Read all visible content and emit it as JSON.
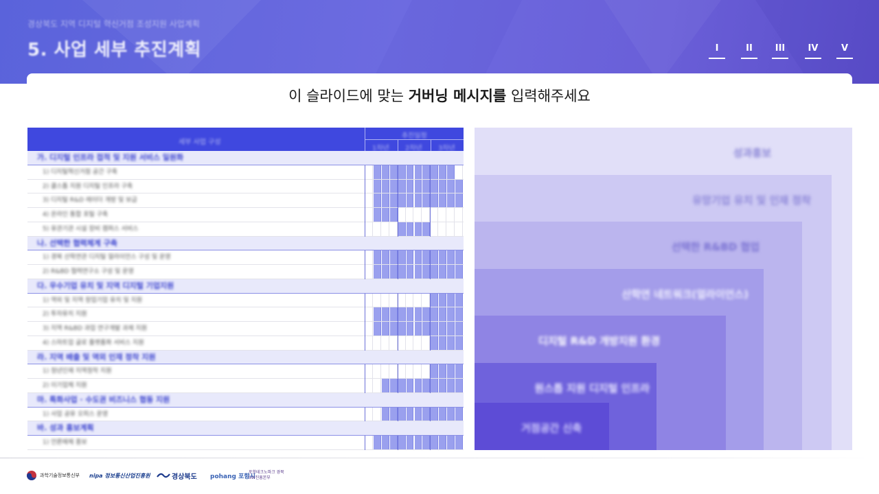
{
  "header": {
    "breadcrumb": "경상북도 지역 디지털 혁신거점 조성지원 사업계획",
    "title": "5. 사업 세부 추진계획",
    "nav": [
      "I",
      "II",
      "III",
      "IV",
      "V"
    ]
  },
  "governing_message": {
    "prefix": "이 슬라이드에 맞는 ",
    "bold": "거버닝 메시지를",
    "suffix": " 입력해주세요"
  },
  "table": {
    "header_left": "세부 사업 구성",
    "header_group": "추진일정",
    "header_years": [
      "1차년",
      "2차년",
      "3차년"
    ],
    "rows": [
      {
        "type": "cat",
        "label": "가. 디지털 인프라 접적 및 지원 서비스 일원화"
      },
      {
        "type": "sub",
        "label": "1) 디지털혁신거점 공간 구축",
        "fill": [
          0,
          1,
          1,
          1,
          1,
          1,
          1,
          1,
          1,
          1,
          1,
          0
        ]
      },
      {
        "type": "sub",
        "label": "2) 클스톱 지원 디지털 인프라 구축",
        "fill": [
          0,
          1,
          1,
          1,
          1,
          1,
          1,
          1,
          1,
          1,
          1,
          1
        ]
      },
      {
        "type": "sub",
        "label": "3) 디지털 R&D 레이더 개방 및 보급",
        "fill": [
          0,
          1,
          1,
          1,
          1,
          1,
          1,
          1,
          1,
          1,
          1,
          1
        ]
      },
      {
        "type": "sub",
        "label": "4) 온라인 통합 포털 구축",
        "fill": [
          0,
          1,
          1,
          1,
          0,
          0,
          0,
          0,
          0,
          0,
          0,
          0
        ]
      },
      {
        "type": "sub",
        "label": "5) 유관기관 시설 장비 캠퍼스 서비스",
        "fill": [
          0,
          0,
          0,
          0,
          1,
          1,
          1,
          1,
          0,
          0,
          0,
          0
        ]
      },
      {
        "type": "cat",
        "label": "나. 선택한 협력체계 구축"
      },
      {
        "type": "sub",
        "label": "1) 경북 산학연관 디지털 얼라이언스 구성 및 운영",
        "fill": [
          0,
          1,
          1,
          1,
          1,
          1,
          1,
          1,
          1,
          1,
          1,
          1
        ]
      },
      {
        "type": "sub",
        "label": "2) R&BD 협력연구소 구성 및 운영",
        "fill": [
          0,
          1,
          1,
          1,
          1,
          1,
          1,
          1,
          1,
          1,
          1,
          1
        ]
      },
      {
        "type": "cat",
        "label": "다. 우수기업 유치 및 지역 디지털 기업지원"
      },
      {
        "type": "sub",
        "label": "1) 역외 및 지역 창업기업 유치 및 지원",
        "fill": [
          0,
          0,
          0,
          0,
          0,
          0,
          0,
          0,
          1,
          1,
          1,
          1
        ]
      },
      {
        "type": "sub",
        "label": "2) 투자유치 지원",
        "fill": [
          0,
          1,
          1,
          1,
          1,
          1,
          1,
          1,
          1,
          1,
          1,
          1
        ]
      },
      {
        "type": "sub",
        "label": "3) 지역 R&BD 과업 연구개발 과제 지원",
        "fill": [
          0,
          1,
          1,
          1,
          1,
          1,
          1,
          1,
          1,
          1,
          1,
          1
        ]
      },
      {
        "type": "sub",
        "label": "4) 스마트업 글로 플랫폼화 서비스 지원",
        "fill": [
          0,
          0,
          0,
          0,
          0,
          0,
          0,
          0,
          1,
          1,
          1,
          1
        ]
      },
      {
        "type": "cat",
        "label": "라. 지역 배출 및 역외 인재 정착 지원"
      },
      {
        "type": "sub",
        "label": "1) 청년인재 지역정착 지원",
        "fill": [
          0,
          0,
          0,
          0,
          0,
          0,
          0,
          0,
          1,
          1,
          1,
          1
        ]
      },
      {
        "type": "sub",
        "label": "2) 이기업체 지원",
        "fill": [
          0,
          0,
          1,
          1,
          1,
          1,
          1,
          1,
          1,
          1,
          1,
          1
        ]
      },
      {
        "type": "cat",
        "label": "마. 특화사업 · 수도권 비즈니스 협동 지원"
      },
      {
        "type": "sub",
        "label": "1) 사업 공유 오피스 운영",
        "fill": [
          0,
          0,
          1,
          1,
          1,
          1,
          1,
          1,
          1,
          1,
          1,
          1
        ]
      },
      {
        "type": "cat",
        "label": "바. 성과 홍보계획"
      },
      {
        "type": "sub",
        "label": "1) 언론매체 홍보",
        "fill": [
          0,
          1,
          1,
          1,
          1,
          1,
          1,
          1,
          1,
          1,
          1,
          1
        ]
      }
    ]
  },
  "pyramid": {
    "tiers": [
      {
        "label": "성과홍보",
        "text_color": "#8b86d6",
        "bg": "#e1dff8"
      },
      {
        "label": "유망기업 유치 및 인재 정착",
        "text_color": "#8c86d8",
        "bg": "#cdc9f3"
      },
      {
        "label": "선택한 R&BD 협업",
        "text_color": "#7a72d2",
        "bg": "#bbb5ee"
      },
      {
        "label": "산학연 네트워크(얼라이언스)",
        "text_color": "#f3f2ff",
        "bg": "#a49dea"
      },
      {
        "label": "디지털 R&D 개방지원 환경",
        "text_color": "#ffffff",
        "bg": "#8f84e4"
      },
      {
        "label": "원스톱 지원 디지털 인프라",
        "text_color": "#e9e7ff",
        "bg": "#6f62dc"
      },
      {
        "label": "거점공간 신축",
        "text_color": "#d9d5ff",
        "bg": "#5d4cd6"
      }
    ]
  },
  "footer": {
    "logos": [
      "과학기술정보통신부",
      "nipa 정보통신산업진흥원",
      "경상북도",
      "pohang 포항시",
      "포항테크노파크 경북SW진흥본부"
    ]
  }
}
